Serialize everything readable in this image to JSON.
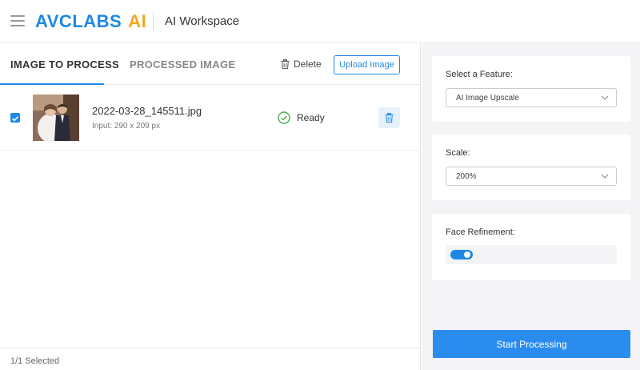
{
  "header": {
    "logo_brand": "AVCLABS",
    "logo_ai": "AI",
    "workspace_title": "AI Workspace",
    "brand_color": "#1e88e5",
    "ai_color": "#f5a623"
  },
  "tabs": [
    {
      "label": "IMAGE TO PROCESS",
      "active": true
    },
    {
      "label": "PROCESSED IMAGE",
      "active": false
    }
  ],
  "toolbar": {
    "delete_label": "Delete",
    "upload_label": "Upload Image"
  },
  "files": [
    {
      "filename": "2022-03-28_145511.jpg",
      "dims": "Input: 290 x 209 px",
      "status": "Ready",
      "checked": true
    }
  ],
  "footer": {
    "selected_text": "1/1 Selected"
  },
  "settings": {
    "feature_label": "Select a Feature:",
    "feature_value": "AI Image Upscale",
    "scale_label": "Scale:",
    "scale_value": "200%",
    "face_label": "Face Refinement:",
    "face_enabled": true
  },
  "actions": {
    "start_label": "Start Processing"
  },
  "icons": {
    "menu": "hamburger-icon",
    "delete": "trash-icon",
    "status": "check-circle-icon",
    "row_delete": "trash-icon",
    "select": "chevron-down-icon"
  }
}
